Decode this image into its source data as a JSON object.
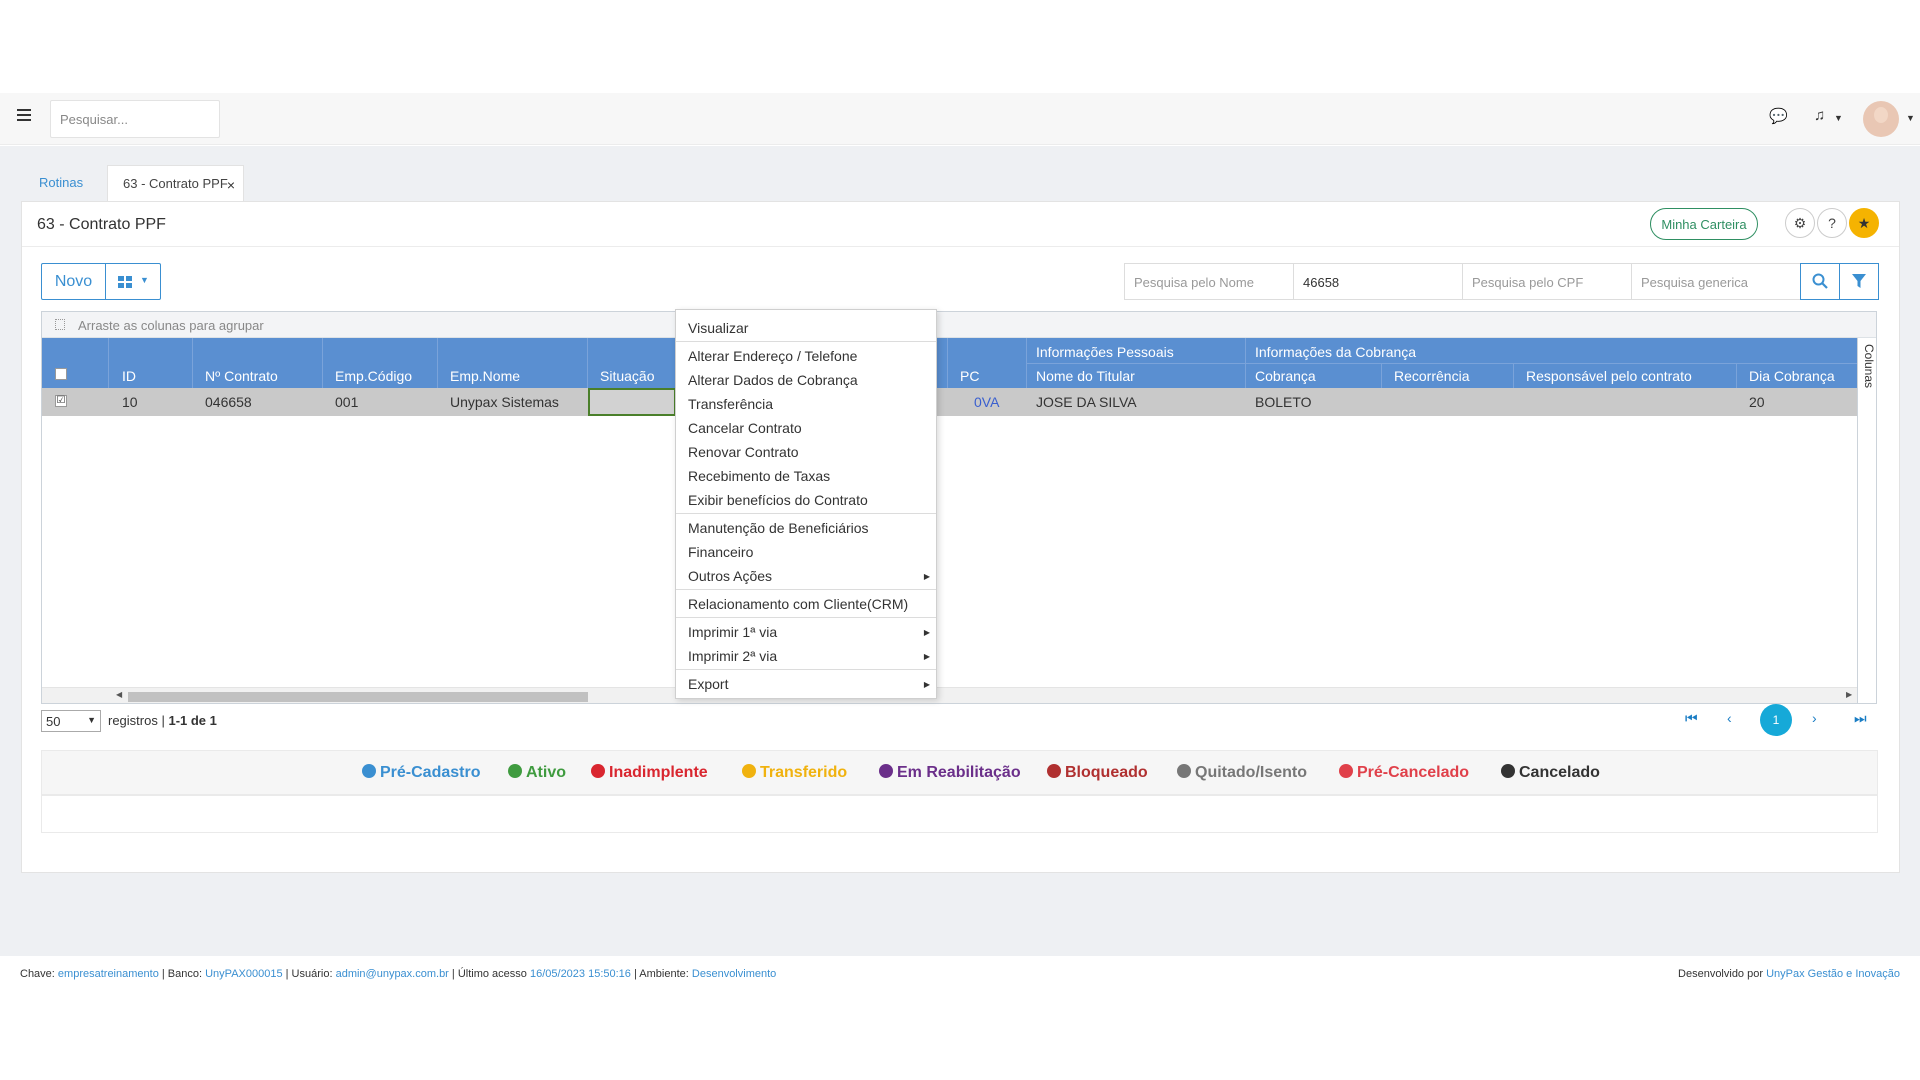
{
  "search": {
    "placeholder": "Pesquisar..."
  },
  "tabs": {
    "rotinas": "Rotinas",
    "active": "63 - Contrato PPF",
    "close": "×"
  },
  "page": {
    "title": "63 - Contrato PPF",
    "minha_carteira": "Minha Carteira"
  },
  "toolbar": {
    "novo": "Novo"
  },
  "filters": {
    "nome_placeholder": "Pesquisa pelo Nome",
    "contrato_value": "46658",
    "cpf_placeholder": "Pesquisa pelo CPF",
    "generica_placeholder": "Pesquisa generica"
  },
  "grid": {
    "group_hint": "Arraste as colunas para agrupar",
    "colunas": "Colunas",
    "group_headers": {
      "pessoais": "Informações Pessoais",
      "cobranca": "Informações da Cobrança"
    },
    "columns": {
      "id": "ID",
      "contrato": "Nº Contrato",
      "emp_codigo": "Emp.Código",
      "emp_nome": "Emp.Nome",
      "situacao": "Situação",
      "pc": "PC",
      "nome_titular": "Nome do Titular",
      "cobranca": "Cobrança",
      "recorrencia": "Recorrência",
      "responsavel": "Responsável pelo contrato",
      "dia_cobranca": "Dia Cobrança"
    },
    "row": {
      "checked": "☑",
      "id": "10",
      "contrato": "046658",
      "emp_codigo": "001",
      "emp_nome": "Unypax Sistemas",
      "pc": "0VA",
      "nome_titular": "JOSE DA SILVA",
      "cobranca": "BOLETO",
      "dia_cobranca": "20"
    }
  },
  "context_menu": [
    "Visualizar",
    "Alterar Endereço / Telefone",
    "Alterar Dados de Cobrança",
    "Transferência",
    "Cancelar Contrato",
    "Renovar Contrato",
    "Recebimento de Taxas",
    "Exibir benefícios do Contrato",
    "Manutenção de Beneficiários",
    "Financeiro",
    "Outros Ações",
    "Relacionamento com Cliente(CRM)",
    "Imprimir 1ª via",
    "Imprimir 2ª via",
    "Export"
  ],
  "pager": {
    "page_size": "50",
    "registros": "registros",
    "range": "1-1 de 1",
    "current": "1"
  },
  "legend": [
    {
      "label": "Pré-Cadastro",
      "color": "#3a8fd1"
    },
    {
      "label": "Ativo",
      "color": "#3f9b3f"
    },
    {
      "label": "Inadimplente",
      "color": "#d9262f"
    },
    {
      "label": "Transferido",
      "color": "#f0b20f"
    },
    {
      "label": "Em Reabilitação",
      "color": "#6b2f8a"
    },
    {
      "label": "Bloqueado",
      "color": "#b03030"
    },
    {
      "label": "Quitado/Isento",
      "color": "#777777"
    },
    {
      "label": "Pré-Cancelado",
      "color": "#e0404a"
    },
    {
      "label": "Cancelado",
      "color": "#333333"
    }
  ],
  "footer": {
    "chave_label": "Chave:",
    "chave": "empresatreinamento",
    "banco_label": "| Banco:",
    "banco": "UnyPAX000015",
    "usuario_label": "| Usuário:",
    "usuario": "admin@unypax.com.br",
    "acesso_label": "| Último acesso",
    "acesso": "16/05/2023 15:50:16",
    "ambiente_label": "| Ambiente:",
    "ambiente": "Desenvolvimento",
    "dev_label": "Desenvolvido por",
    "dev": "UnyPax Gestão e Inovação"
  },
  "colors": {
    "accent": "#3a8fd1",
    "header": "#5a8fd1",
    "star": "#f5b301"
  }
}
